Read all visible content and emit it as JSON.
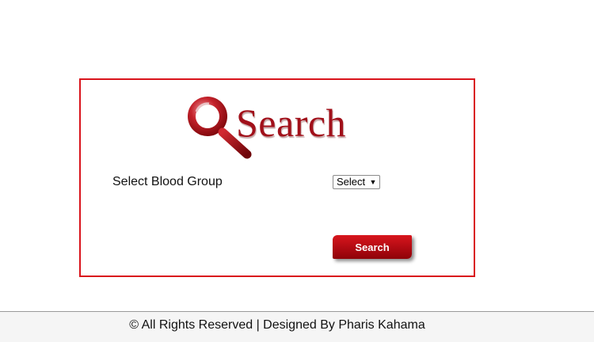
{
  "search_panel": {
    "logo": {
      "text": "Search",
      "icon": "magnifier-icon"
    },
    "blood_group": {
      "label": "Select Blood Group",
      "selected_value": "Select",
      "arrow_icon": "triangle-down-icon"
    },
    "search_button_label": "Search"
  },
  "footer": {
    "text": "© All Rights Reserved | Designed By Pharis Kahama"
  },
  "colors": {
    "accent_red": "#d9141c",
    "logo_red": "#a1101a",
    "button_red": "#b00a12"
  }
}
